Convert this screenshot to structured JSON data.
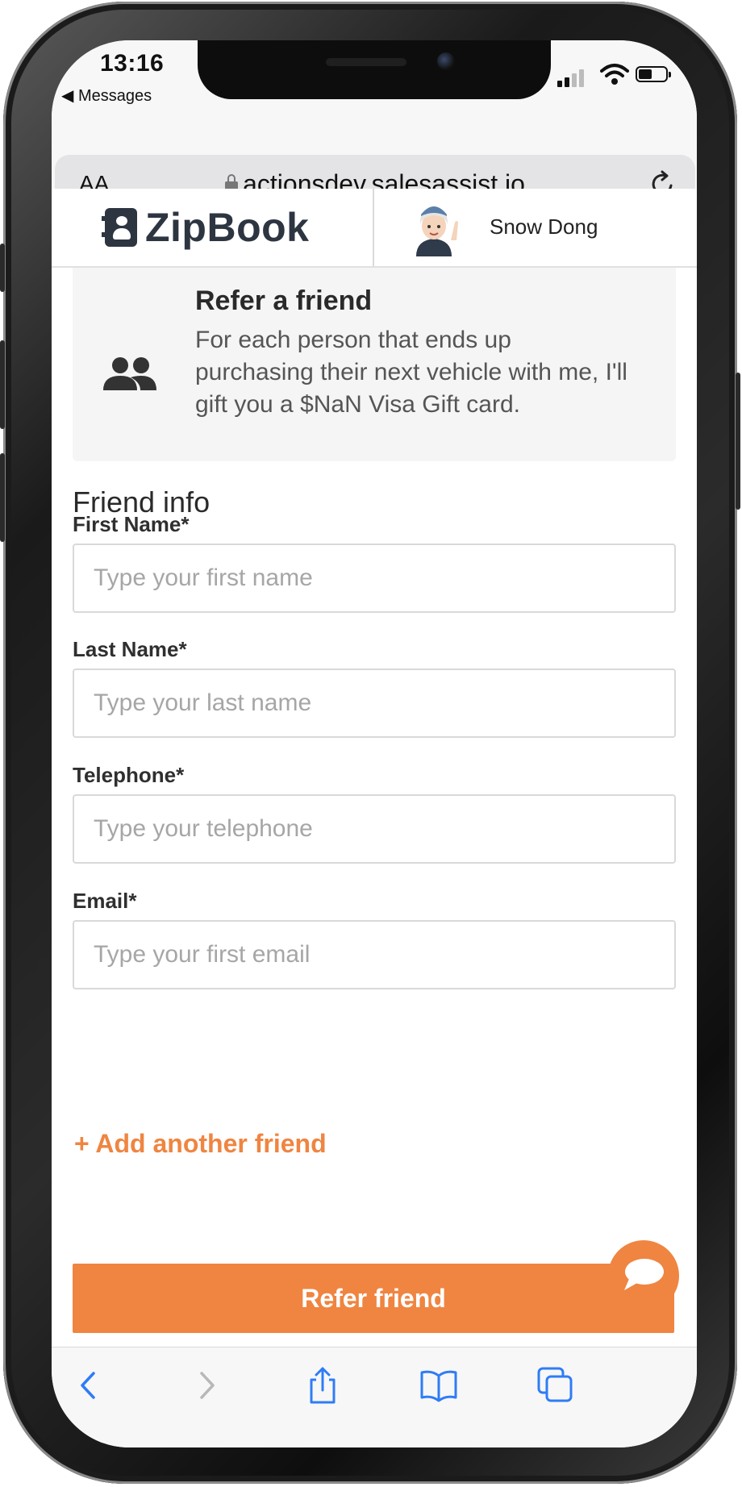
{
  "status_bar": {
    "time": "13:16",
    "back_app": "◀ Messages"
  },
  "address_bar": {
    "text_size_button": "AA",
    "url": "actionsdev.salesassist.io"
  },
  "header": {
    "logo_text": "ZipBook",
    "agent_name": "Snow Dong"
  },
  "promo": {
    "title": "Refer a friend",
    "description": "For each person that ends up purchasing their next vehicle with me, I'll gift you a $NaN Visa Gift card."
  },
  "form": {
    "section_title": "Friend info",
    "fields": [
      {
        "label": "First Name*",
        "placeholder": "Type your first name",
        "value": ""
      },
      {
        "label": "Last Name*",
        "placeholder": "Type your last name",
        "value": ""
      },
      {
        "label": "Telephone*",
        "placeholder": "Type your telephone",
        "value": ""
      },
      {
        "label": "Email*",
        "placeholder": "Type your first email",
        "value": ""
      }
    ],
    "add_friend_label": "+ Add another friend",
    "submit_label": "Refer friend"
  },
  "colors": {
    "accent": "#ef8541",
    "brand": "#2d3541",
    "panel": "#f5f5f5"
  },
  "icons": [
    "lock-icon",
    "reload-icon",
    "people-icon",
    "chat-icon",
    "back-icon",
    "forward-icon",
    "share-icon",
    "bookmarks-icon",
    "tabs-icon"
  ]
}
